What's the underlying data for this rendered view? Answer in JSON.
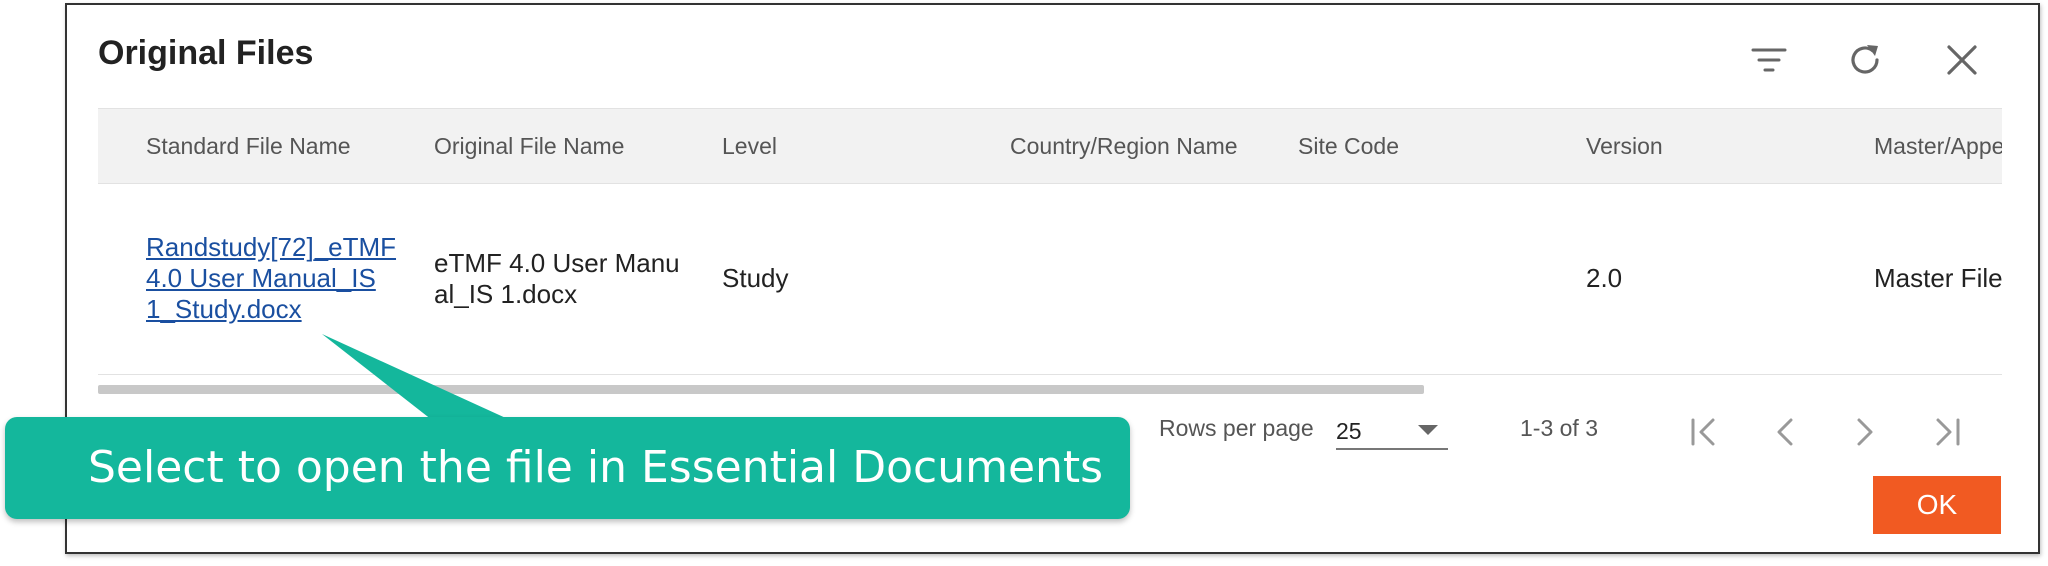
{
  "dialog": {
    "title": "Original Files",
    "toolbar": {
      "filter_icon": "filter-icon",
      "refresh_icon": "refresh-icon",
      "close_icon": "close-icon"
    }
  },
  "table": {
    "columns": [
      "Standard File Name",
      "Original File Name",
      "Level",
      "Country/Region Name",
      "Site Code",
      "Version",
      "Master/Appe"
    ],
    "rows": [
      {
        "standard_file_name": "Randstudy[72]_eTMF 4.0 User Manual_IS 1_Study.docx",
        "original_file_name": "eTMF 4.0 User Manual_IS 1.docx",
        "level": "Study",
        "country_region_name": "",
        "site_code": "",
        "version": "2.0",
        "master_appendix": "Master File"
      }
    ]
  },
  "footer": {
    "rows_per_page_label": "Rows per page",
    "rows_per_page_value": "25",
    "range_text": "1-3 of 3",
    "pager_icons": [
      "first-page-icon",
      "previous-page-icon",
      "next-page-icon",
      "last-page-icon"
    ],
    "ok_label": "OK"
  },
  "callout": {
    "text": "Select to open the file in Essential Documents"
  },
  "colors": {
    "callout": "#14b79c",
    "ok_button": "#f15a22",
    "link": "#1a4fa0",
    "header_bg": "#f2f2f2"
  }
}
